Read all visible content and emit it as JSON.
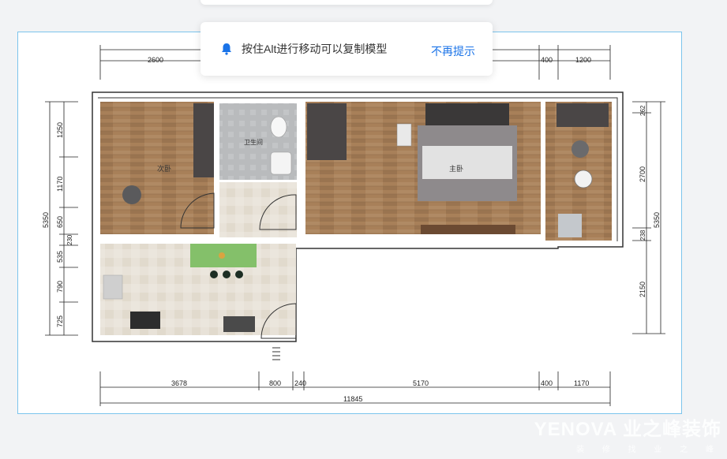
{
  "toast": {
    "icon": "bell-icon",
    "message": "按住Alt进行移动可以复制模型",
    "action_label": "不再提示",
    "accent_color": "#1a73e8"
  },
  "floorplan": {
    "rooms": {
      "second_bedroom": "次卧",
      "bathroom": "卫生间",
      "master_bedroom": "主卧"
    },
    "dimensions": {
      "top_left": "2600",
      "top_mid": "400",
      "top_right": "1200",
      "bottom_1": "3678",
      "bottom_2": "800",
      "bottom_3": "240",
      "bottom_4": "5170",
      "bottom_5": "400",
      "bottom_6": "1170",
      "bottom_total": "11845",
      "left_total": "5350",
      "left_1": "1250",
      "left_2": "1170",
      "left_3": "650",
      "left_4": "230",
      "left_5": "535",
      "left_6": "790",
      "left_7": "725",
      "right_1": "262",
      "right_2": "2700",
      "right_3": "238",
      "right_4": "2150",
      "right_total": "5350"
    }
  },
  "watermark": {
    "brand": "YENOVA 业之峰装饰",
    "sub": "装 修 找 业 之 峰"
  },
  "colors": {
    "wood": "#a57e57",
    "tile": "#e6e0d6",
    "wall": "#4a4646",
    "frame": "#7cc4ec"
  }
}
